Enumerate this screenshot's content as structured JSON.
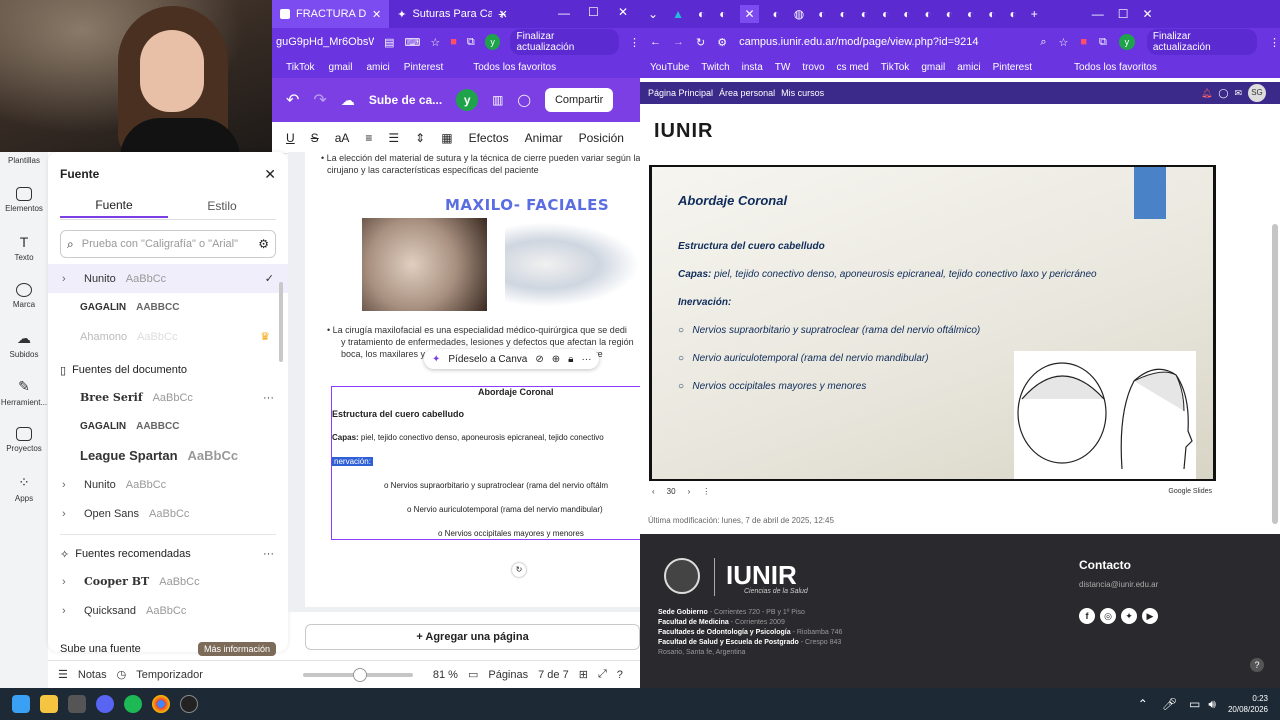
{
  "canva_browser": {
    "tabs": [
      {
        "label": "FRACTURA DE CRA"
      },
      {
        "label": "Suturas Para Cada"
      }
    ],
    "address": "guG9pHd_Mr6ObsWg...",
    "update_label": "Finalizar actualización",
    "bookmarks": [
      "TikTok",
      "gmail",
      "amici",
      "Pinterest",
      "Todos los favoritos"
    ]
  },
  "canva_bar": {
    "upload_label": "Sube de ca...",
    "avatar_letter": "y",
    "share_label": "Compartir"
  },
  "canva_toolbar": {
    "effects": "Efectos",
    "animate": "Animar",
    "position": "Posición"
  },
  "sidebar": {
    "items": [
      {
        "label": "Plantillas",
        "icon": "templates-icon"
      },
      {
        "label": "Elementos",
        "icon": "elements-icon"
      },
      {
        "label": "Texto",
        "icon": "text-icon"
      },
      {
        "label": "Marca",
        "icon": "brand-icon"
      },
      {
        "label": "Subidos",
        "icon": "upload-icon"
      },
      {
        "label": "Herramient...",
        "icon": "tools-icon"
      },
      {
        "label": "Proyectos",
        "icon": "folder-icon"
      },
      {
        "label": "Apps",
        "icon": "apps-icon"
      }
    ]
  },
  "font_panel": {
    "title": "Fuente",
    "tab_font": "Fuente",
    "tab_style": "Estilo",
    "search_placeholder": "Prueba con \"Caligrafía\" o \"Arial\"",
    "top_fonts": [
      {
        "name": "Nunito",
        "sample": "AaBbCc"
      },
      {
        "name": "GAGALIN",
        "sample": "AABBCC"
      },
      {
        "name": "Ahamono",
        "sample": "AaBbCc"
      }
    ],
    "doc_section": "Fuentes del documento",
    "doc_fonts": [
      {
        "name": "Bree Serif",
        "sample": "AaBbCc"
      },
      {
        "name": "GAGALIN",
        "sample": "AABBCC"
      },
      {
        "name": "League Spartan",
        "sample": "AaBbCc"
      },
      {
        "name": "Nunito",
        "sample": "AaBbCc"
      },
      {
        "name": "Open Sans",
        "sample": "AaBbCc"
      }
    ],
    "rec_section": "Fuentes recomendadas",
    "rec_fonts": [
      {
        "name": "Cooper BT",
        "sample": "AaBbCc"
      },
      {
        "name": "Quicksand",
        "sample": "AaBbCc"
      }
    ],
    "upload_font": "Sube una fuente",
    "more_info": "Más información"
  },
  "canva_page": {
    "bullet1": "La elección del material de sutura y la técnica de cierre pueden variar según la",
    "bullet1b": "cirujano y las características específicas del paciente",
    "heading": "MAXILO- FACIALES",
    "bullet2a": "La cirugía maxilofacial es una especialidad médico-quirúrgica que se dedi",
    "bullet2b": "y tratamiento de enfermedades, lesiones y defectos que afectan la región",
    "bullet2c": "boca, los maxilares y",
    "bullet2d": "as áre",
    "popup_label": "Pídeselo a Canva",
    "box_title": "Abordaje Coronal",
    "box_sub": "Estructura del cuero cabelludo",
    "box_capas_label": "Capas:",
    "box_capas": "piel, tejido conectivo denso, aponeurosis epicraneal, tejido conectivo",
    "box_inerv": "nervación:",
    "box_n1": "o Nervios supraorbitario y supratroclear (rama del nervio oftálm",
    "box_n2": "o Nervio auriculotemporal (rama del nervio mandibular)",
    "box_n3": "o Nervios occipitales mayores y menores",
    "add_page": "+ Agregar una página"
  },
  "canva_bottom": {
    "notes": "Notas",
    "timer": "Temporizador",
    "zoom": "81 %",
    "pages_label": "Páginas",
    "page_count": "7 de 7"
  },
  "moodle_browser": {
    "address": "campus.iunir.edu.ar/mod/page/view.php?id=9214",
    "update_label": "Finalizar actualización",
    "bookmarks": [
      "YouTube",
      "Twitch",
      "insta",
      "TW",
      "trovo",
      "cs med",
      "TikTok",
      "gmail",
      "amici",
      "Pinterest",
      "Todos los favoritos"
    ]
  },
  "moodle_nav": {
    "home": "Página Principal",
    "personal": "Área personal",
    "courses": "Mis cursos",
    "avatar": "SG"
  },
  "moodle_body": {
    "logo": "IUNIR",
    "slide_title": "Abordaje Coronal",
    "slide_sub": "Estructura del cuero cabelludo",
    "slide_capas_label": "Capas:",
    "slide_capas": "piel, tejido conectivo denso, aponeurosis epicraneal, tejido conectivo laxo y pericráneo",
    "slide_inerv": "Inervación:",
    "slide_n1": "Nervios supraorbitario y supratroclear (rama del nervio oftálmico)",
    "slide_n2": "Nervio auriculotemporal (rama del nervio mandibular)",
    "slide_n3": "Nervios occipitales mayores y menores",
    "slide_num": "30",
    "google_slides": "Google Slides",
    "last_mod": "Última modificación: lunes, 7 de abril de 2025, 12:45"
  },
  "moodle_footer": {
    "logo": "IUNIR",
    "logo_sub": "Ciencias de la Salud",
    "contact_title": "Contacto",
    "contact_email": "distancia@iunir.edu.ar",
    "lines": [
      {
        "label": "Sede Gobierno",
        "text": "- Corrientes 720 - PB y 1º Piso"
      },
      {
        "label": "Facultad de Medicina",
        "text": "- Corrientes 2009"
      },
      {
        "label": "Facultades de Odontología y Psicología",
        "text": "- Riobamba 746"
      },
      {
        "label": "Facultad de Salud y Escuela de Postgrado",
        "text": "- Crespo 843"
      },
      {
        "label": "",
        "text": "Rosario, Santa fe, Argentina"
      }
    ]
  },
  "taskbar": {
    "time": "0:23",
    "date": "20/08/2026"
  },
  "colors": {
    "canva_purple": "#7b3fe4",
    "chrome_purple": "#6a35e0",
    "slide_text": "#0f2c5a",
    "footer_bg": "#2a2a2e"
  }
}
